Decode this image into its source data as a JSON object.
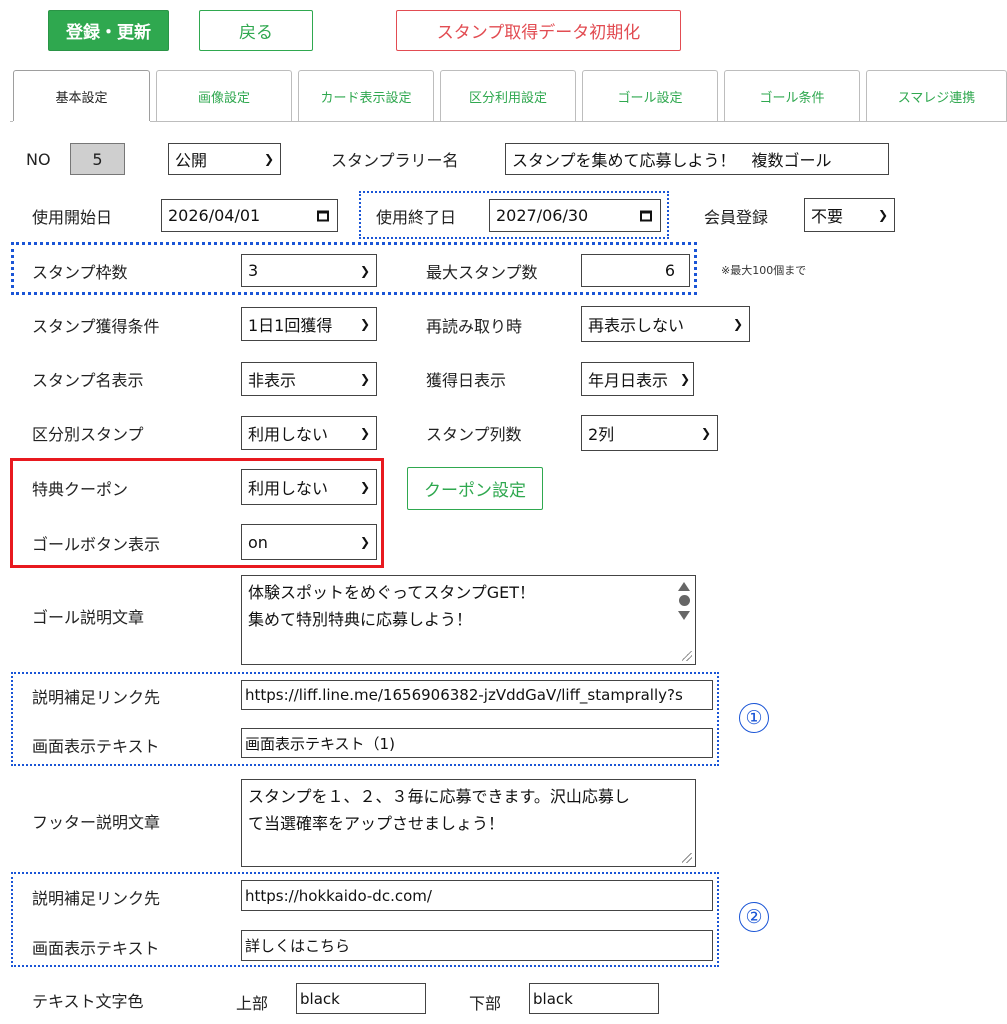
{
  "toolbar": {
    "register_label": "登録・更新",
    "back_label": "戻る",
    "reset_label": "スタンプ取得データ初期化"
  },
  "tabs": [
    {
      "label": "基本設定",
      "active": true
    },
    {
      "label": "画像設定"
    },
    {
      "label": "カード表示設定"
    },
    {
      "label": "区分利用設定"
    },
    {
      "label": "ゴール設定"
    },
    {
      "label": "ゴール条件"
    },
    {
      "label": "スマレジ連携"
    }
  ],
  "form": {
    "no_label": "NO",
    "no_value": "5",
    "publish_value": "公開",
    "rally_name_label": "スタンプラリー名",
    "rally_name_value": "スタンプを集めて応募しよう！　複数ゴール",
    "start_date_label": "使用開始日",
    "start_date_value": "2026/04/01",
    "end_date_label": "使用終了日",
    "end_date_value": "2027/06/30",
    "member_reg_label": "会員登録",
    "member_reg_value": "不要",
    "stamp_slots_label": "スタンプ枠数",
    "stamp_slots_value": "3",
    "max_stamps_label": "最大スタンプ数",
    "max_stamps_value": "6",
    "max_stamps_note": "※最大100個まで",
    "acquire_cond_label": "スタンプ獲得条件",
    "acquire_cond_value": "1日1回獲得",
    "reread_label": "再読み取り時",
    "reread_value": "再表示しない",
    "stamp_name_label": "スタンプ名表示",
    "stamp_name_value": "非表示",
    "acquire_date_label": "獲得日表示",
    "acquire_date_value": "年月日表示",
    "category_stamp_label": "区分別スタンプ",
    "category_stamp_value": "利用しない",
    "columns_label": "スタンプ列数",
    "columns_value": "2列",
    "coupon_label": "特典クーポン",
    "coupon_value": "利用しない",
    "coupon_button": "クーポン設定",
    "goal_button_label": "ゴールボタン表示",
    "goal_button_value": "on",
    "goal_desc_label": "ゴール説明文章",
    "goal_desc_line1": "体験スポットをめぐってスタンプGET！",
    "goal_desc_line2": "集めて特別特典に応募しよう！",
    "link1_label": "説明補足リンク先",
    "link1_value": "https://liff.line.me/1656906382-jzVddGaV/liff_stamprally?s",
    "display_text1_label": "画面表示テキスト",
    "display_text1_value": "画面表示テキスト（1)",
    "marker1": "①",
    "footer_desc_label": "フッター説明文章",
    "footer_desc_line1": "スタンプを１、２、３毎に応募できます。沢山応募し",
    "footer_desc_line2": "て当選確率をアップさせましょう！",
    "link2_label": "説明補足リンク先",
    "link2_value": "https://hokkaido-dc.com/",
    "display_text2_label": "画面表示テキスト",
    "display_text2_value": "詳しくはこちら",
    "marker2": "②",
    "text_color_label": "テキスト文字色",
    "top_label": "上部",
    "top_value": "black",
    "bottom_label": "下部",
    "bottom_value": "black"
  },
  "colors": {
    "primary_green": "#2fa84f",
    "danger_red": "#e24c52",
    "highlight_red": "#e8191f",
    "annotation_blue": "#1a55d6"
  },
  "icons": {
    "select_arrow": "chevron-down-icon",
    "date_picker": "calendar-icon"
  }
}
